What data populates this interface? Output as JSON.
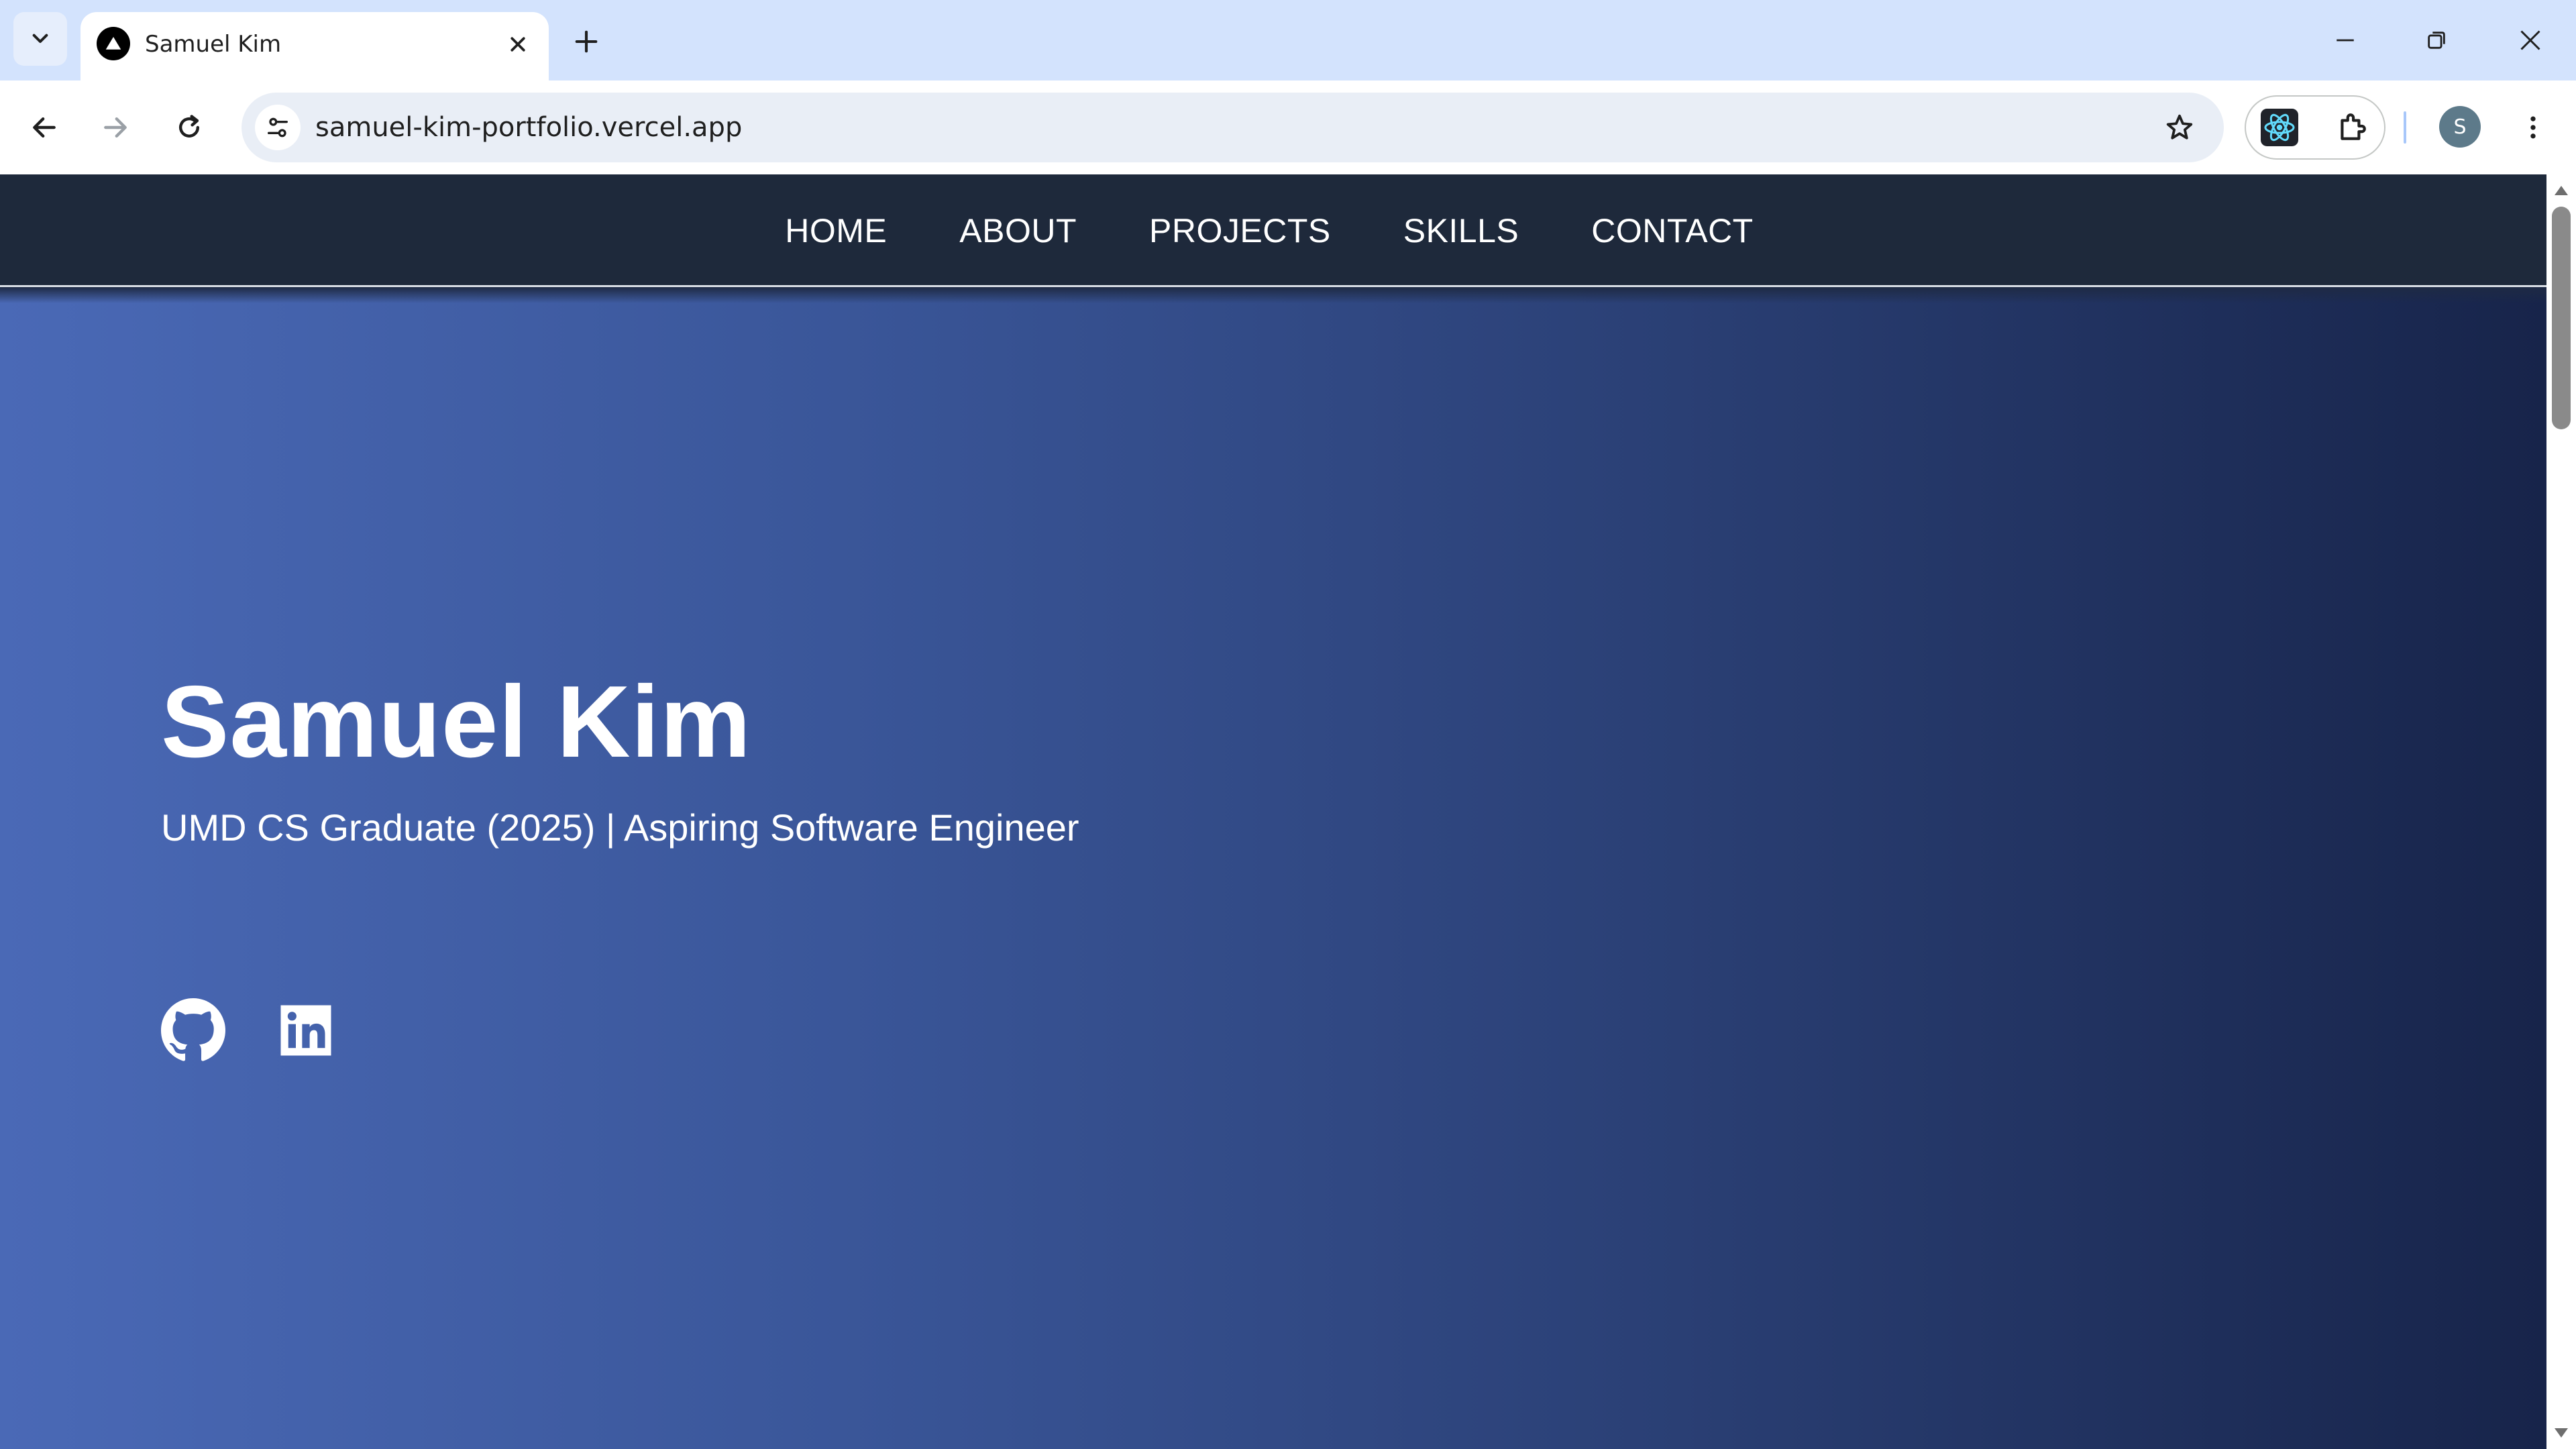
{
  "browser": {
    "tab": {
      "title": "Samuel Kim"
    },
    "address_bar": {
      "url": "samuel-kim-portfolio.vercel.app"
    },
    "profile_initial": "S"
  },
  "site": {
    "nav": {
      "items": [
        {
          "label": "HOME"
        },
        {
          "label": "ABOUT"
        },
        {
          "label": "PROJECTS"
        },
        {
          "label": "SKILLS"
        },
        {
          "label": "CONTACT"
        }
      ]
    },
    "hero": {
      "name": "Samuel Kim",
      "subtitle": "UMD CS Graduate (2025) | Aspiring Software Engineer",
      "social_icons": [
        "github-icon",
        "linkedin-icon"
      ]
    }
  },
  "colors": {
    "tabstrip": "#d3e3fd",
    "nav_background": "#1e293b",
    "hero_gradient_start": "#4a69b6",
    "hero_gradient_end": "#17244a",
    "text": "#ffffff"
  }
}
